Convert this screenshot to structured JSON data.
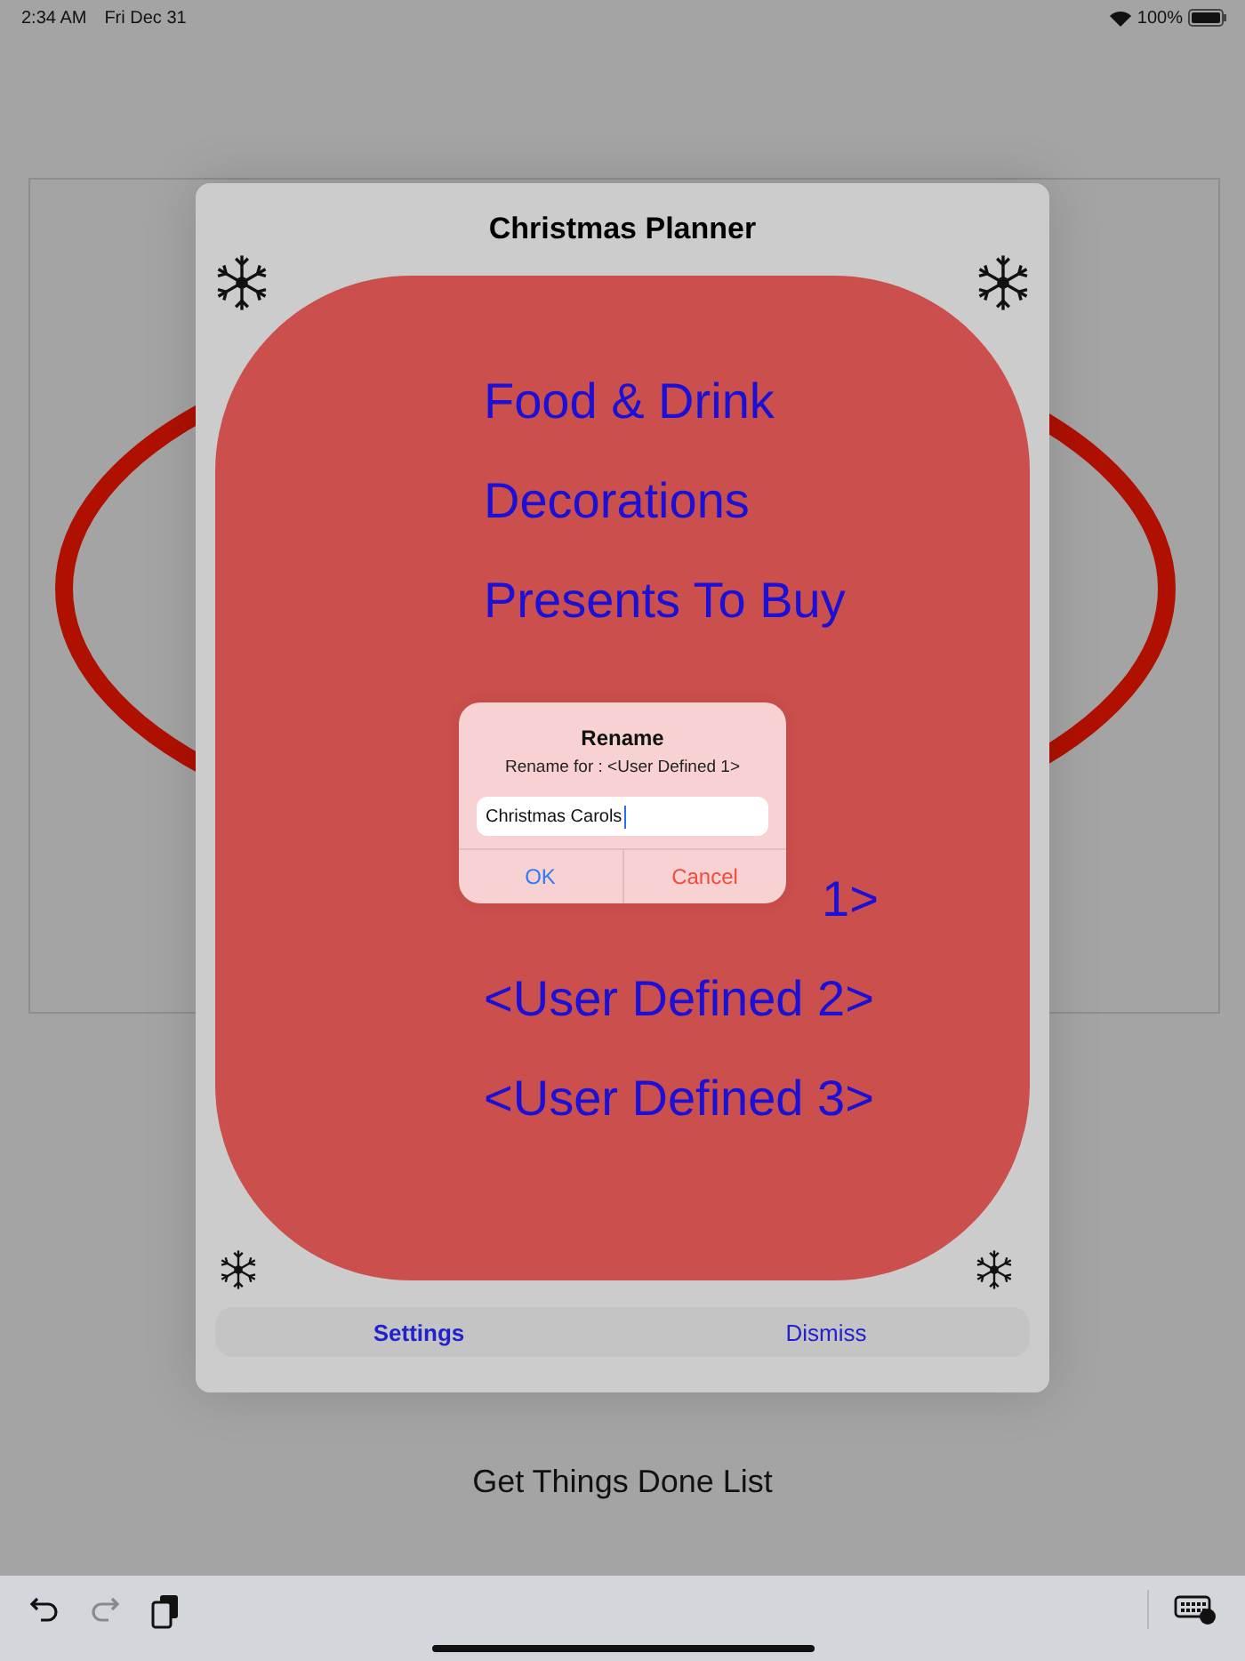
{
  "status_bar": {
    "time": "2:34 AM",
    "date": "Fri Dec 31",
    "battery": "100%"
  },
  "background": {
    "title": "Get Things Done List"
  },
  "planner": {
    "title": "Christmas Planner",
    "items": [
      {
        "text": "Food & Drink",
        "kind": "full"
      },
      {
        "text": "Decorations",
        "kind": "full"
      },
      {
        "text": "Presents To Buy",
        "kind": "full"
      },
      {
        "text": "1>",
        "kind": "tail"
      },
      {
        "text": "<User Defined 2>",
        "kind": "full"
      },
      {
        "text": "<User Defined 3>",
        "kind": "full"
      }
    ],
    "buttons": [
      {
        "label": "Settings",
        "preferred": true
      },
      {
        "label": "Dismiss",
        "preferred": false
      }
    ]
  },
  "dialog": {
    "title": "Rename",
    "message": "Rename for : <User Defined 1>",
    "field": {
      "value": "Christmas Carols"
    },
    "buttons": [
      {
        "label": "OK",
        "kind": "default"
      },
      {
        "label": "Cancel",
        "kind": "destructive"
      }
    ]
  },
  "toolbar": [
    {
      "kind": "undo",
      "disabled": false
    },
    {
      "kind": "redo",
      "disabled": true
    },
    {
      "kind": "paste",
      "disabled": false
    },
    {
      "kind": "keyboard",
      "disabled": false
    }
  ]
}
